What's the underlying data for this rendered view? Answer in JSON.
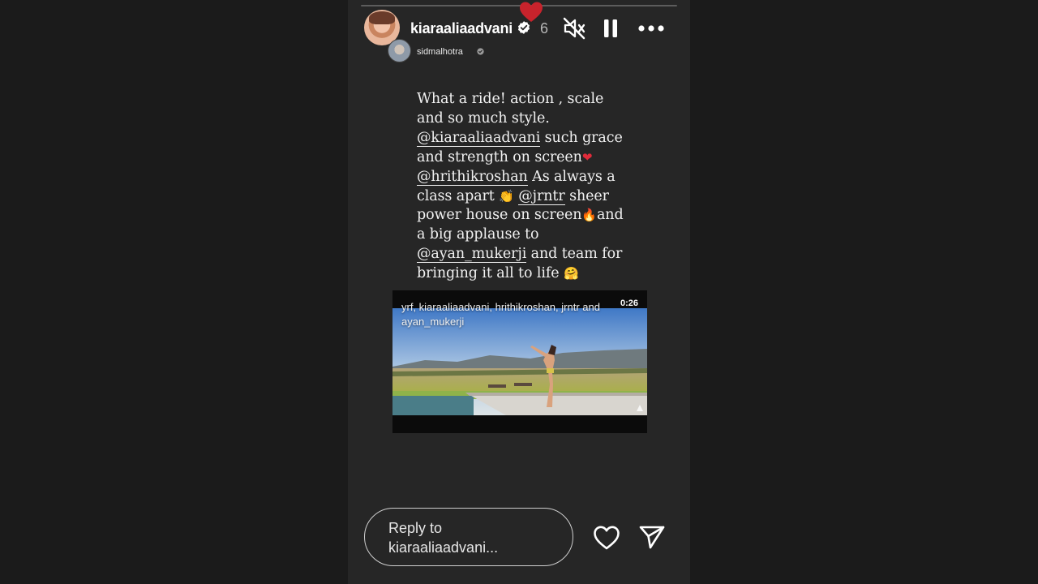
{
  "story": {
    "progress_fraction": 0.0,
    "author": {
      "username": "kiaraaliaadvani",
      "verified": true,
      "time_ago": "6"
    },
    "reshared_from": {
      "username": "sidmalhotra",
      "verified": true
    },
    "caption_lines": [
      [
        {
          "t": " What a ride! action , scale"
        }
      ],
      [
        {
          "t": "and so much style."
        }
      ],
      [
        {
          "t": "@kiaraaliaadvani",
          "m": true
        },
        {
          "t": " such grace"
        }
      ],
      [
        {
          "t": "and strength on screen"
        },
        {
          "e": "❤",
          "c": "e-heart"
        }
      ],
      [
        {
          "t": "@hrithikroshan",
          "m": true
        },
        {
          "t": " As always a"
        }
      ],
      [
        {
          "t": "class apart "
        },
        {
          "e": "👏",
          "c": "e-clap"
        },
        {
          "t": " "
        },
        {
          "t": "@jrntr",
          "m": true
        },
        {
          "t": " sheer"
        }
      ],
      [
        {
          "t": "power house on screen"
        },
        {
          "e": "🔥",
          "c": "e-fire"
        },
        {
          "t": "and"
        }
      ],
      [
        {
          "t": "a big applause to"
        }
      ],
      [
        {
          "t": "@ayan_mukerji",
          "m": true
        },
        {
          "t": " and team for"
        }
      ],
      [
        {
          "t": "bringing it all to life "
        },
        {
          "e": "🤗",
          "c": "e-hug"
        }
      ]
    ],
    "reel": {
      "caption": "yrf, kiaraaliaadvani, hrithikroshan, jrntr and ayan_mukerji",
      "duration": "0:26"
    },
    "reply_placeholder": "Reply to\nkiaraaliaadvani...",
    "icons": {
      "mute": "speaker-muted-icon",
      "pause": "pause-icon",
      "more": "more-horizontal-icon",
      "like": "heart-outline-icon",
      "send": "send-icon",
      "verified": "verified-badge-icon"
    },
    "colors": {
      "background": "#1b1b1b",
      "story_bg": "#262626",
      "heart_red": "#c8232c"
    }
  }
}
